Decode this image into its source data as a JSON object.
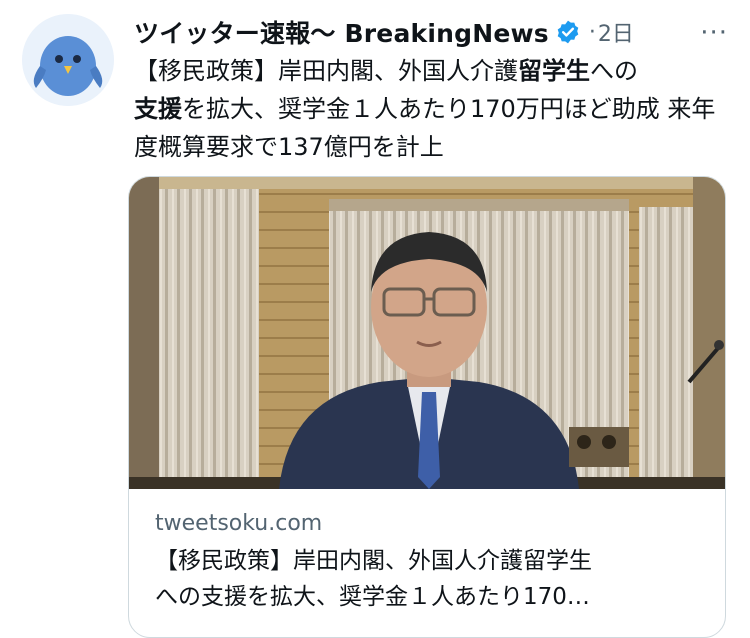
{
  "tweet": {
    "author": "ツイッター速報〜 BreakingNews",
    "time": "2日",
    "text_parts": [
      "【移民政策】岸田内閣、外国人介護",
      "留学生",
      "への",
      "支援",
      "を拡大、奨学金１人あたり170万円ほど助成 来年度概算要求で137億円を計上"
    ]
  },
  "card": {
    "domain": "tweetsoku.com",
    "title_line1": "【移民政策】岸田内閣、外国人介護留学生",
    "title_line2": "への支援を拡大、奨学金１人あたり170…"
  },
  "colors": {
    "verified": "#1d9bf0",
    "secondary_text": "#536471",
    "card_border": "#cfd9de"
  },
  "icons": {
    "avatar": "blue-bird-avatar",
    "verified": "verified-badge-icon",
    "more": "more-options-icon"
  }
}
